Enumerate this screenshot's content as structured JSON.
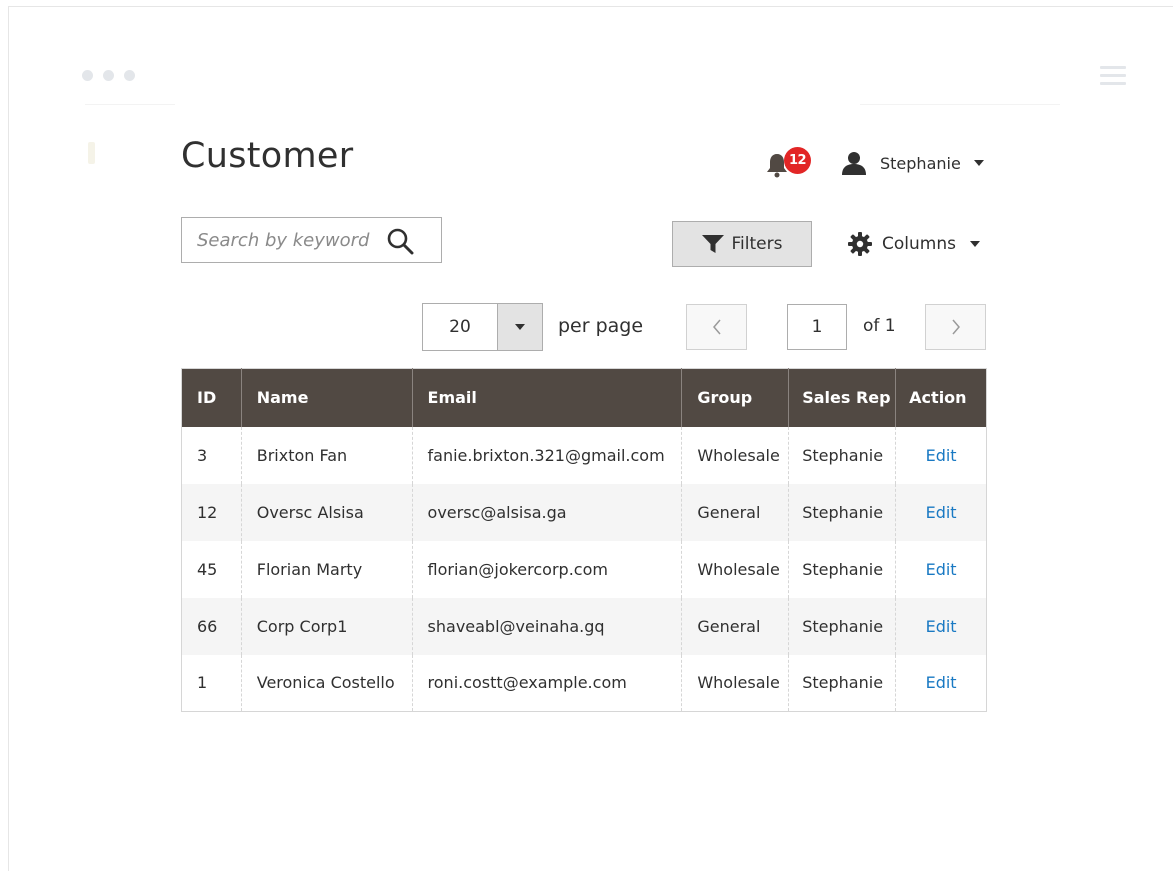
{
  "header": {
    "title": "Customer",
    "notifications_count": "12",
    "user_name": "Stephanie"
  },
  "toolbar": {
    "search_placeholder": "Search by keyword",
    "filters_label": "Filters",
    "columns_label": "Columns"
  },
  "pagination": {
    "per_page_value": "20",
    "per_page_label": "per page",
    "current_page": "1",
    "of_label": "of 1"
  },
  "table": {
    "columns": [
      "ID",
      "Name",
      "Email",
      "Group",
      "Sales Rep",
      "Action"
    ],
    "rows": [
      {
        "id": "3",
        "name": "Brixton Fan",
        "email": "fanie.brixton.321@gmail.com",
        "group": "Wholesale",
        "sales_rep": "Stephanie",
        "action": "Edit"
      },
      {
        "id": "12",
        "name": "Oversc Alsisa",
        "email": "oversc@alsisa.ga",
        "group": "General",
        "sales_rep": "Stephanie",
        "action": "Edit"
      },
      {
        "id": "45",
        "name": "Florian Marty",
        "email": "florian@jokercorp.com",
        "group": "Wholesale",
        "sales_rep": "Stephanie",
        "action": "Edit"
      },
      {
        "id": "66",
        "name": "Corp Corp1",
        "email": "shaveabl@veinaha.gq",
        "group": "General",
        "sales_rep": "Stephanie",
        "action": "Edit"
      },
      {
        "id": "1",
        "name": "Veronica Costello",
        "email": "roni.costt@example.com",
        "group": "Wholesale",
        "sales_rep": "Stephanie",
        "action": "Edit"
      }
    ]
  },
  "colors": {
    "header_bg": "#514943",
    "badge": "#e22626",
    "link": "#1979c3"
  },
  "icons": [
    "bell-icon",
    "user-icon",
    "search-icon",
    "filter-icon",
    "gear-icon",
    "chevron-left-icon",
    "chevron-right-icon"
  ]
}
